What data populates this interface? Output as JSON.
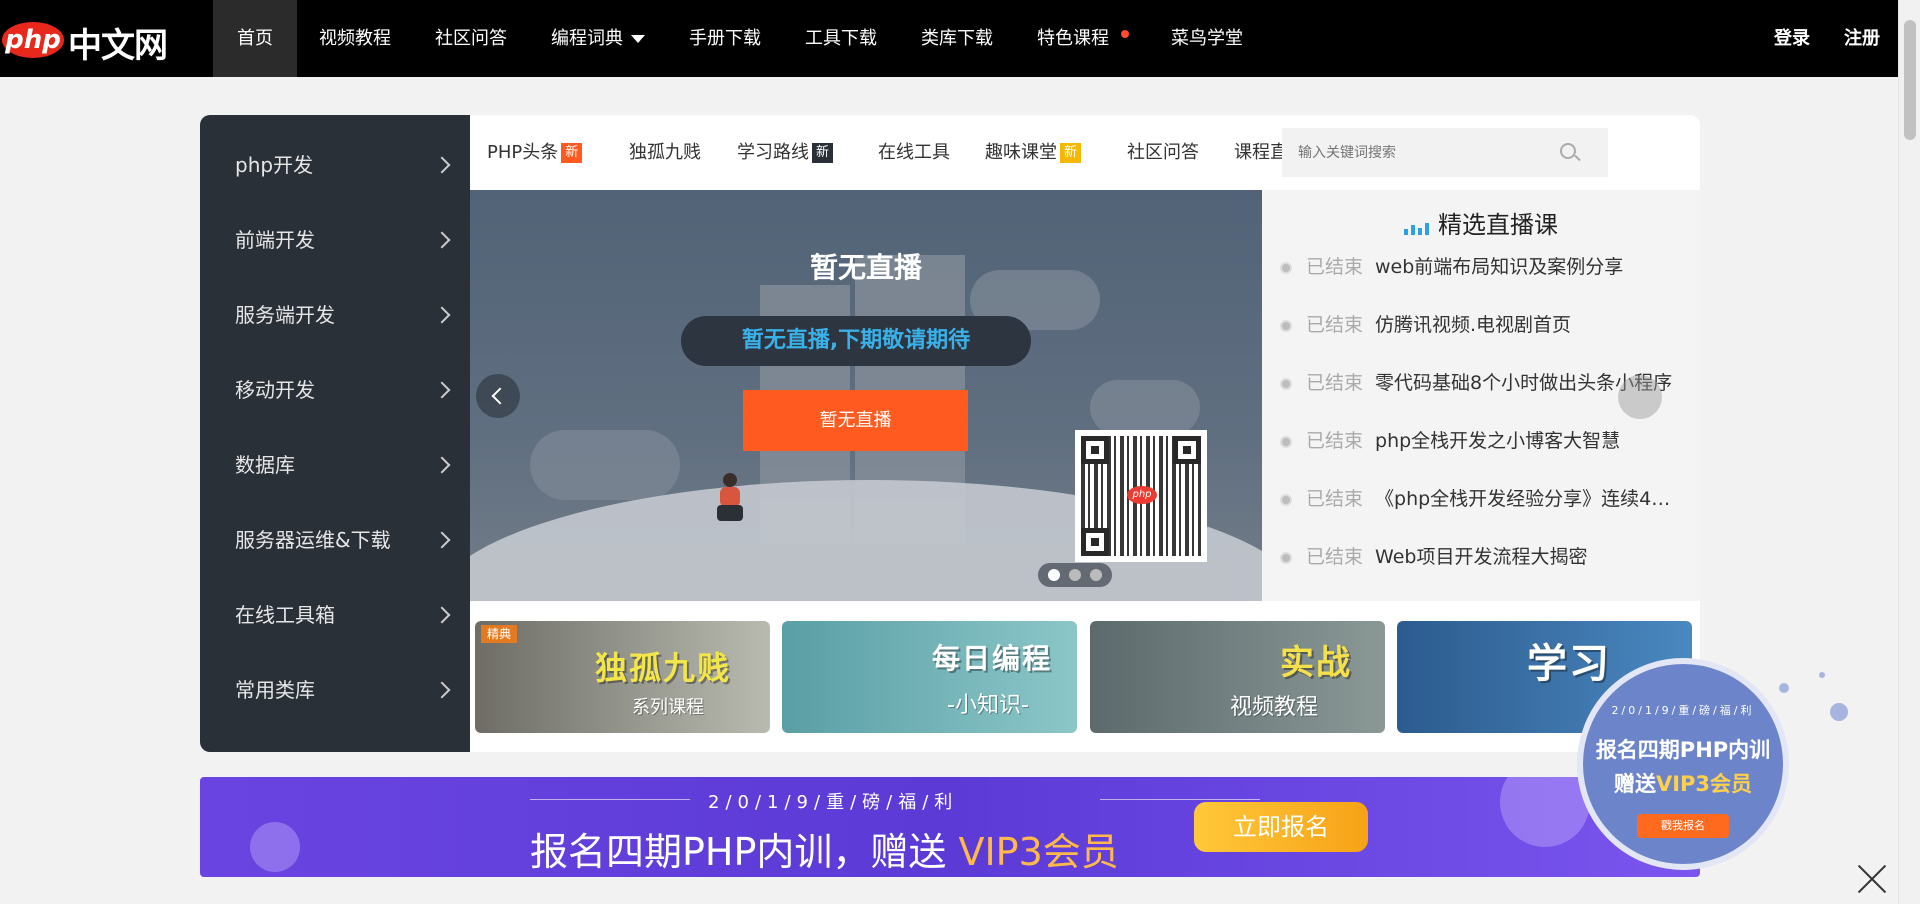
{
  "brand": {
    "logo_pill": "php",
    "logo_text": "中文网"
  },
  "topnav": {
    "items": [
      "首页",
      "视频教程",
      "社区问答",
      "编程词典",
      "手册下载",
      "工具下载",
      "类库下载",
      "特色课程",
      "菜鸟学堂"
    ],
    "active": "首页",
    "login": "登录",
    "register": "注册"
  },
  "sidebar": {
    "items": [
      "php开发",
      "前端开发",
      "服务端开发",
      "移动开发",
      "数据库",
      "服务器运维&下载",
      "在线工具箱",
      "常用类库"
    ]
  },
  "subnav": {
    "items": [
      {
        "label": "PHP头条",
        "tag": "新",
        "tag_color": "#ff5a1f"
      },
      {
        "label": "独孤九贱",
        "tag": ""
      },
      {
        "label": "学习路线",
        "tag": "新",
        "tag_color": "#2a3038"
      },
      {
        "label": "在线工具",
        "tag": ""
      },
      {
        "label": "趣味课堂",
        "tag": "新",
        "tag_color": "#f5b800"
      },
      {
        "label": "社区问答",
        "tag": ""
      },
      {
        "label": "课程直播",
        "tag": ""
      }
    ],
    "search_placeholder": "输入关键词搜索"
  },
  "banner": {
    "title": "暂无直播",
    "pill": "暂无直播,下期敬请期待",
    "button": "暂无直播",
    "qr_badge": "php",
    "slides": 3,
    "active_slide": 1
  },
  "live": {
    "heading": "精选直播课",
    "items": [
      {
        "status": "已结束",
        "title": "web前端布局知识及案例分享"
      },
      {
        "status": "已结束",
        "title": "仿腾讯视频.电视剧首页"
      },
      {
        "status": "已结束",
        "title": "零代码基础8个小时做出头条小程序"
      },
      {
        "status": "已结束",
        "title": "php全栈开发之小博客大智慧"
      },
      {
        "status": "已结束",
        "title": "《php全栈开发经验分享》连续4…"
      },
      {
        "status": "已结束",
        "title": "Web项目开发流程大揭密"
      }
    ]
  },
  "tiles": [
    {
      "tag": "精典",
      "big": "独孤九贱",
      "small": "系列课程"
    },
    {
      "big": "每日编程",
      "small": "-小知识-"
    },
    {
      "big": "实战",
      "small": "视频教程"
    },
    {
      "big": "学习",
      "small": ""
    }
  ],
  "promo": {
    "sub": "2/0/1/9/重/磅/福/利",
    "main_prefix": "报名四期PHP内训，赠送 ",
    "main_vip": "VIP3会员",
    "button": "立即报名"
  },
  "float_promo": {
    "sub": "2/0/1/9/重/磅/福/利",
    "line1": "报名四期PHP内训",
    "line2_prefix": "赠送",
    "line2_vip": "VIP3会员",
    "button": "戳我报名"
  }
}
